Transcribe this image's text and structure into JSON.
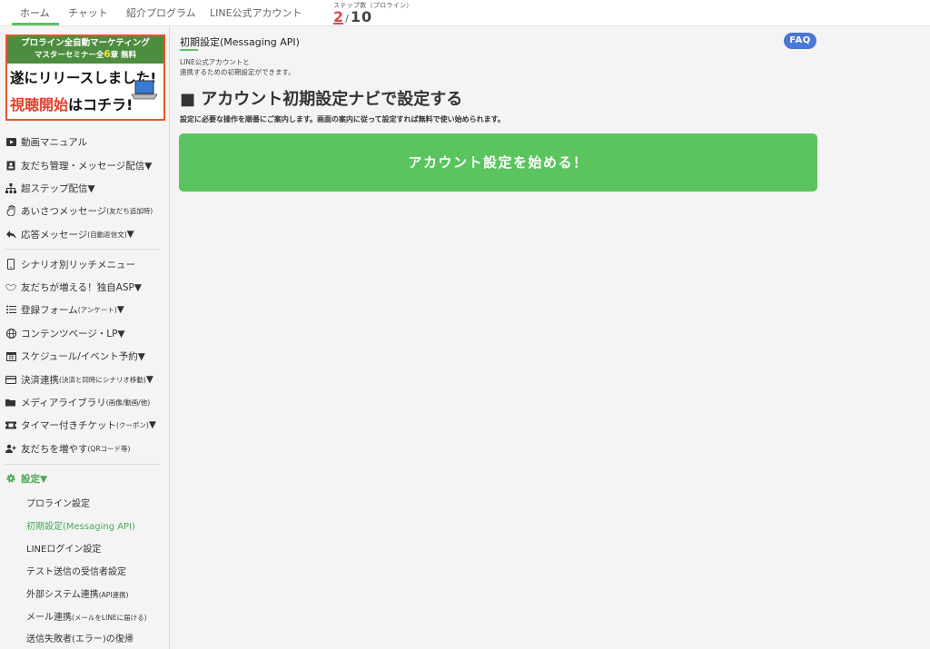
{
  "topnav": {
    "tabs": [
      {
        "label": "ホーム"
      },
      {
        "label": "チャット"
      },
      {
        "label": "紹介プログラム"
      },
      {
        "label": "LINE公式アカウント"
      }
    ],
    "step": {
      "label": "ステップ数（プロライン）",
      "current": "2",
      "separator": "/",
      "total": "10"
    }
  },
  "banner": {
    "line1": "プロライン全自動マーケティング",
    "line2_pre": "マスターセミナー全",
    "line2_num": "6",
    "line2_post": "章 無料",
    "line3": "遂にリリースしました!",
    "line4_red": "視聴開始",
    "line4_black": "はコチラ!"
  },
  "sidebar": {
    "items": [
      {
        "label": "動画マニュアル",
        "note": ""
      },
      {
        "label": "友だち管理・メッセージ配信▼",
        "note": ""
      },
      {
        "label": "超ステップ配信▼",
        "note": ""
      },
      {
        "label": "あいさつメッセージ",
        "note": "(友だち追加時)"
      },
      {
        "label": "応答メッセージ",
        "note": "(自動返信文)",
        "tail": "▼"
      },
      {
        "label": "シナリオ別リッチメニュー",
        "note": ""
      },
      {
        "label": "友だちが増える！独自ASP▼",
        "note": ""
      },
      {
        "label": "登録フォーム",
        "note": "(アンケート)",
        "tail": "▼"
      },
      {
        "label": "コンテンツページ・LP▼",
        "note": ""
      },
      {
        "label": "スケジュール/イベント予約▼",
        "note": ""
      },
      {
        "label": "決済連携",
        "note": "(決済と同時にシナリオ移動)",
        "tail": "▼"
      },
      {
        "label": "メディアライブラリ",
        "note": "(画像/動画/他)"
      },
      {
        "label": "タイマー付きチケット",
        "note": "(クーポン)",
        "tail": "▼"
      },
      {
        "label": "友だちを増やす",
        "note": "(QRコード等)"
      },
      {
        "label": "設定▼",
        "note": ""
      }
    ],
    "sub_items": [
      {
        "label": "プロライン設定",
        "note": ""
      },
      {
        "label": "初期設定(Messaging API)",
        "note": ""
      },
      {
        "label": "LINEログイン設定",
        "note": ""
      },
      {
        "label": "テスト送信の受信者設定",
        "note": ""
      },
      {
        "label": "外部システム連携",
        "note": "(API連携)"
      },
      {
        "label": "メール連携",
        "note": "(メールをLINEに届ける)"
      },
      {
        "label": "送信失敗者(エラー)の復帰",
        "note": ""
      }
    ]
  },
  "main": {
    "title": "初期設定(Messaging API)",
    "faq": "FAQ",
    "desc_line1": "LINE公式アカウントと",
    "desc_line2": "連携するための初期設定ができます。",
    "heading": "■ アカウント初期設定ナビで設定する",
    "subdesc": "設定に必要な操作を順番にご案内します。画面の案内に従って設定すれば無料で使い始められます。",
    "start_button": "アカウント設定を始める！"
  },
  "colors": {
    "accent": "#5bc45f",
    "faq": "#4a78d8",
    "step_current": "#d94b4b",
    "banner_border": "#e8542a",
    "banner_green": "#4d8d3f"
  }
}
